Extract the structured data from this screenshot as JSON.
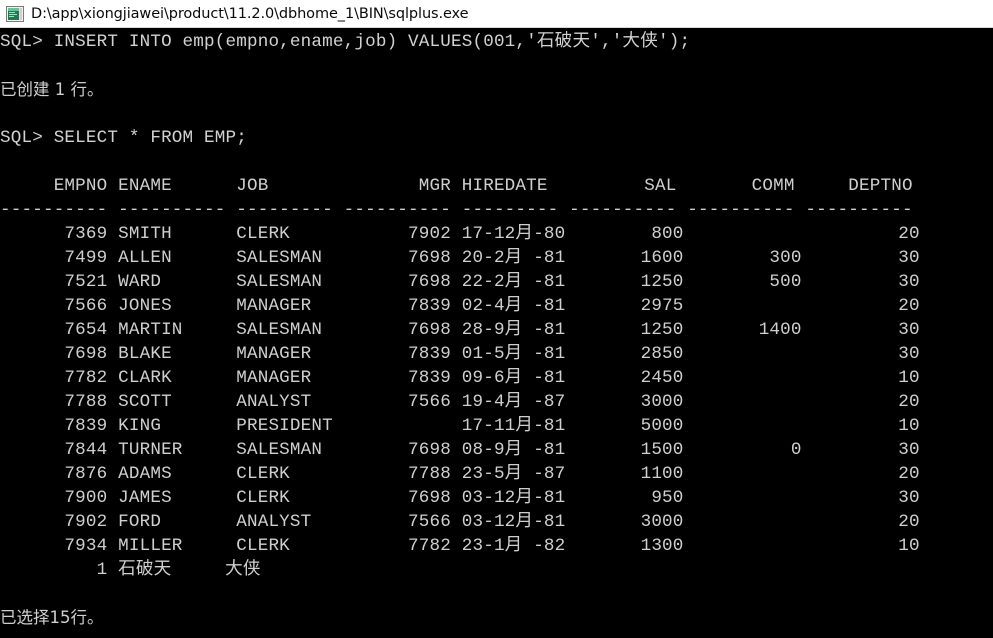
{
  "window": {
    "title": "D:\\app\\xiongjiawei\\product\\11.2.0\\dbhome_1\\BIN\\sqlplus.exe",
    "icon": "console-window-icon",
    "titlebar_bg": "#ffffff",
    "titlebar_fg": "#0a0a0a",
    "console_bg": "#000000",
    "console_fg": "#cfcfcf"
  },
  "console": {
    "prompt": "SQL> ",
    "lines": [
      {
        "kind": "command",
        "text": "SQL> INSERT INTO emp(empno,ename,job) VALUES(001,'石破天','大侠');"
      },
      {
        "kind": "blank",
        "text": ""
      },
      {
        "kind": "message",
        "text": "已创建 1 行。"
      },
      {
        "kind": "blank",
        "text": ""
      },
      {
        "kind": "command",
        "text": "SQL> SELECT * FROM EMP;"
      },
      {
        "kind": "blank",
        "text": ""
      }
    ],
    "footer": "已选择15行。",
    "insert_statement": {
      "verb": "INSERT INTO",
      "table": "emp",
      "columns": [
        "empno",
        "ename",
        "job"
      ],
      "values": [
        "001",
        "'石破天'",
        "'大侠'"
      ],
      "raw": "INSERT INTO emp(empno,ename,job) VALUES(001,'石破天','大侠');"
    },
    "insert_result": "已创建 1 行。",
    "select_statement": {
      "raw": "SELECT * FROM EMP;"
    }
  },
  "result_table": {
    "columns": [
      {
        "name": "EMPNO",
        "align": "right",
        "width": 10,
        "rule": "----------"
      },
      {
        "name": "ENAME",
        "align": "left",
        "width": 10,
        "rule": "----------"
      },
      {
        "name": "JOB",
        "align": "left",
        "width": 9,
        "rule": "---------"
      },
      {
        "name": "MGR",
        "align": "right",
        "width": 10,
        "rule": "----------"
      },
      {
        "name": "HIREDATE",
        "align": "left",
        "width": 9,
        "rule": "---------"
      },
      {
        "name": "SAL",
        "align": "right",
        "width": 10,
        "rule": "----------"
      },
      {
        "name": "COMM",
        "align": "right",
        "width": 10,
        "rule": "----------"
      },
      {
        "name": "DEPTNO",
        "align": "right",
        "width": 10,
        "rule": "----------"
      }
    ],
    "header_line": "     EMPNO ENAME      JOB              MGR HIREDATE         SAL       COMM     DEPTNO",
    "rule_line": "---------- ---------- --------- ---------- --------- ---------- ---------- ----------",
    "rows": [
      {
        "EMPNO": "7369",
        "ENAME": "SMITH",
        "JOB": "CLERK",
        "MGR": "7902",
        "HIREDATE": "17-12月-80",
        "SAL": "800",
        "COMM": "",
        "DEPTNO": "20"
      },
      {
        "EMPNO": "7499",
        "ENAME": "ALLEN",
        "JOB": "SALESMAN",
        "MGR": "7698",
        "HIREDATE": "20-2月 -81",
        "SAL": "1600",
        "COMM": "300",
        "DEPTNO": "30"
      },
      {
        "EMPNO": "7521",
        "ENAME": "WARD",
        "JOB": "SALESMAN",
        "MGR": "7698",
        "HIREDATE": "22-2月 -81",
        "SAL": "1250",
        "COMM": "500",
        "DEPTNO": "30"
      },
      {
        "EMPNO": "7566",
        "ENAME": "JONES",
        "JOB": "MANAGER",
        "MGR": "7839",
        "HIREDATE": "02-4月 -81",
        "SAL": "2975",
        "COMM": "",
        "DEPTNO": "20"
      },
      {
        "EMPNO": "7654",
        "ENAME": "MARTIN",
        "JOB": "SALESMAN",
        "MGR": "7698",
        "HIREDATE": "28-9月 -81",
        "SAL": "1250",
        "COMM": "1400",
        "DEPTNO": "30"
      },
      {
        "EMPNO": "7698",
        "ENAME": "BLAKE",
        "JOB": "MANAGER",
        "MGR": "7839",
        "HIREDATE": "01-5月 -81",
        "SAL": "2850",
        "COMM": "",
        "DEPTNO": "30"
      },
      {
        "EMPNO": "7782",
        "ENAME": "CLARK",
        "JOB": "MANAGER",
        "MGR": "7839",
        "HIREDATE": "09-6月 -81",
        "SAL": "2450",
        "COMM": "",
        "DEPTNO": "10"
      },
      {
        "EMPNO": "7788",
        "ENAME": "SCOTT",
        "JOB": "ANALYST",
        "MGR": "7566",
        "HIREDATE": "19-4月 -87",
        "SAL": "3000",
        "COMM": "",
        "DEPTNO": "20"
      },
      {
        "EMPNO": "7839",
        "ENAME": "KING",
        "JOB": "PRESIDENT",
        "MGR": "",
        "HIREDATE": "17-11月-81",
        "SAL": "5000",
        "COMM": "",
        "DEPTNO": "10"
      },
      {
        "EMPNO": "7844",
        "ENAME": "TURNER",
        "JOB": "SALESMAN",
        "MGR": "7698",
        "HIREDATE": "08-9月 -81",
        "SAL": "1500",
        "COMM": "0",
        "DEPTNO": "30"
      },
      {
        "EMPNO": "7876",
        "ENAME": "ADAMS",
        "JOB": "CLERK",
        "MGR": "7788",
        "HIREDATE": "23-5月 -87",
        "SAL": "1100",
        "COMM": "",
        "DEPTNO": "20"
      },
      {
        "EMPNO": "7900",
        "ENAME": "JAMES",
        "JOB": "CLERK",
        "MGR": "7698",
        "HIREDATE": "03-12月-81",
        "SAL": "950",
        "COMM": "",
        "DEPTNO": "30"
      },
      {
        "EMPNO": "7902",
        "ENAME": "FORD",
        "JOB": "ANALYST",
        "MGR": "7566",
        "HIREDATE": "03-12月-81",
        "SAL": "3000",
        "COMM": "",
        "DEPTNO": "20"
      },
      {
        "EMPNO": "7934",
        "ENAME": "MILLER",
        "JOB": "CLERK",
        "MGR": "7782",
        "HIREDATE": "23-1月 -82",
        "SAL": "1300",
        "COMM": "",
        "DEPTNO": "10"
      },
      {
        "EMPNO": "1",
        "ENAME": "石破天",
        "JOB": "大侠",
        "MGR": "",
        "HIREDATE": "",
        "SAL": "",
        "COMM": "",
        "DEPTNO": ""
      }
    ],
    "row_count": 15,
    "row_count_message": "已选择15行。"
  }
}
